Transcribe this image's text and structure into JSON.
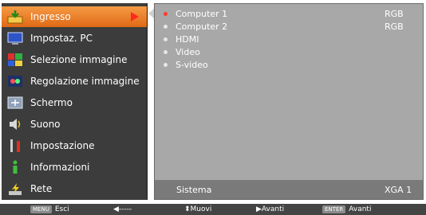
{
  "menu": {
    "items": [
      {
        "label": "Ingresso",
        "icon": "input-icon",
        "active": true
      },
      {
        "label": "Impostaz. PC",
        "icon": "pc-adjust-icon",
        "active": false
      },
      {
        "label": "Selezione immagine",
        "icon": "image-select-icon",
        "active": false
      },
      {
        "label": "Regolazione immagine",
        "icon": "image-adjust-icon",
        "active": false
      },
      {
        "label": "Schermo",
        "icon": "screen-icon",
        "active": false
      },
      {
        "label": "Suono",
        "icon": "sound-icon",
        "active": false
      },
      {
        "label": "Impostazione",
        "icon": "setting-icon",
        "active": false
      },
      {
        "label": "Informazioni",
        "icon": "information-icon",
        "active": false
      },
      {
        "label": "Rete",
        "icon": "network-icon",
        "active": false
      }
    ]
  },
  "sources": [
    {
      "name": "Computer 1",
      "signal": "RGB",
      "selected": true
    },
    {
      "name": "Computer 2",
      "signal": "RGB",
      "selected": false
    },
    {
      "name": "HDMI",
      "signal": "",
      "selected": false
    },
    {
      "name": "Video",
      "signal": "",
      "selected": false
    },
    {
      "name": "S-video",
      "signal": "",
      "selected": false
    }
  ],
  "system": {
    "label": "Sistema",
    "value": "XGA 1"
  },
  "help": {
    "exit_key": "MENU",
    "exit_label": "Esci",
    "back_label": "◀-----",
    "move_label": "⬍Muovi",
    "next_label": "▶Avanti",
    "enter_key": "ENTER",
    "enter_label": "Avanti"
  },
  "colors": {
    "accent": "#f08a30",
    "selected_bullet": "#ff3b2b",
    "panel": "#a8a8a8",
    "menu": "#3c3c3c"
  }
}
